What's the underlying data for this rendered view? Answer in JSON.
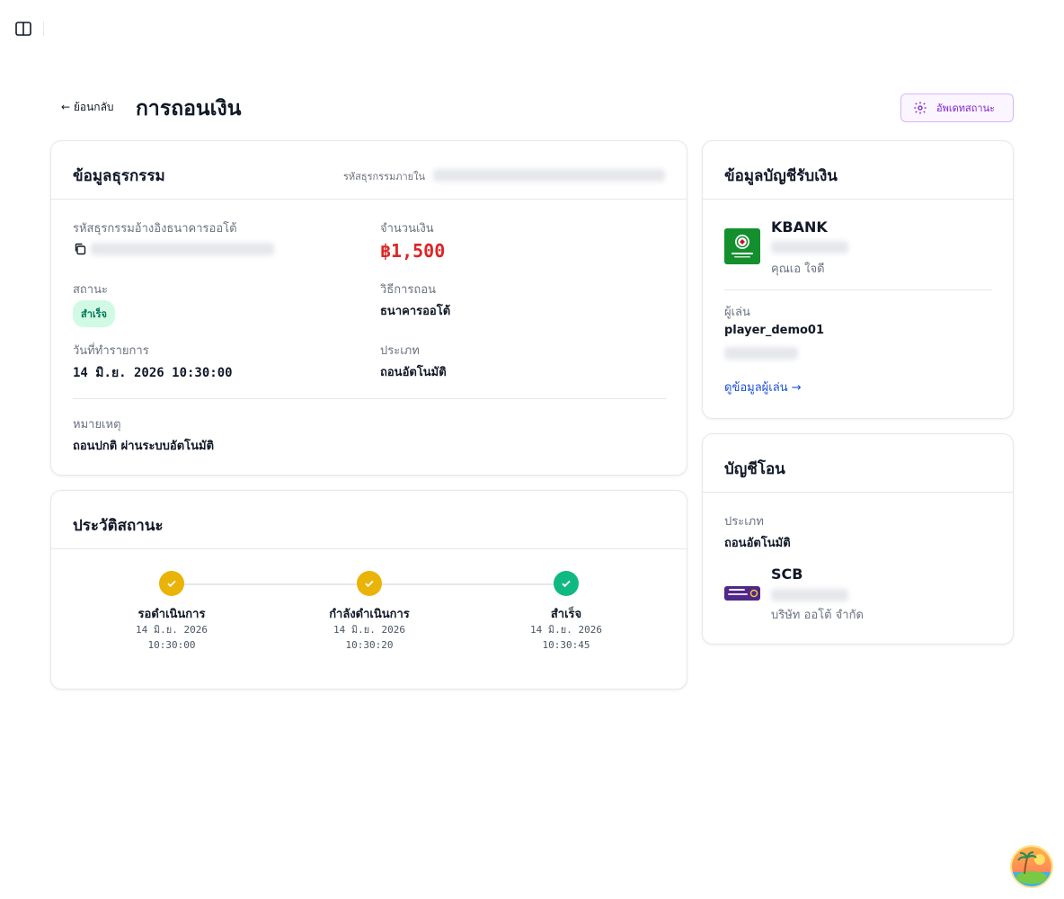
{
  "header": {
    "back_label": "← ย้อนกลับ",
    "title": "การถอนเงิน",
    "update_button": "อัพเดทสถานะ"
  },
  "transaction": {
    "title": "ข้อมูลธุรกรรม",
    "internal_id_label": "รหัสธุรกรรมภายใน",
    "ref_label": "รหัสธุรกรรมอ้างอิงธนาคารออโต้",
    "amount_label": "จำนวนเงิน",
    "amount": "฿1,500",
    "status_label": "สถานะ",
    "status_value": "สำเร็จ",
    "method_label": "วิธีการถอน",
    "method_value": "ธนาคารออโต้",
    "date_label": "วันที่ทำรายการ",
    "date_value": "14 มิ.ย. 2026 10:30:00",
    "type_label": "ประเภท",
    "type_value": "ถอนอัตโนมัติ",
    "note_label": "หมายเหตุ",
    "note_value": "ถอนปกติ ผ่านระบบอัตโนมัติ"
  },
  "history": {
    "title": "ประวัติสถานะ",
    "steps": [
      {
        "label": "รอดำเนินการ",
        "date": "14 มิ.ย. 2026",
        "time": "10:30:00",
        "color": "#eab308"
      },
      {
        "label": "กำลังดำเนินการ",
        "date": "14 มิ.ย. 2026",
        "time": "10:30:20",
        "color": "#eab308"
      },
      {
        "label": "สำเร็จ",
        "date": "14 มิ.ย. 2026",
        "time": "10:30:45",
        "color": "#10b981"
      }
    ]
  },
  "receiving_account": {
    "title": "ข้อมูลบัญชีรับเงิน",
    "bank_name": "KBANK",
    "account_holder": "คุณเอ ใจดี",
    "player_label": "ผู้เล่น",
    "player_name": "player_demo01",
    "player_link": "ดูข้อมูลผู้เล่น →",
    "bank_color": "#138f2d"
  },
  "transfer_account": {
    "title": "บัญชีโอน",
    "type_label": "ประเภท",
    "type_value": "ถอนอัตโนมัติ",
    "bank_name": "SCB",
    "company": "บริษัท ออโต้ จำกัด",
    "bank_color": "#4e2a84"
  }
}
